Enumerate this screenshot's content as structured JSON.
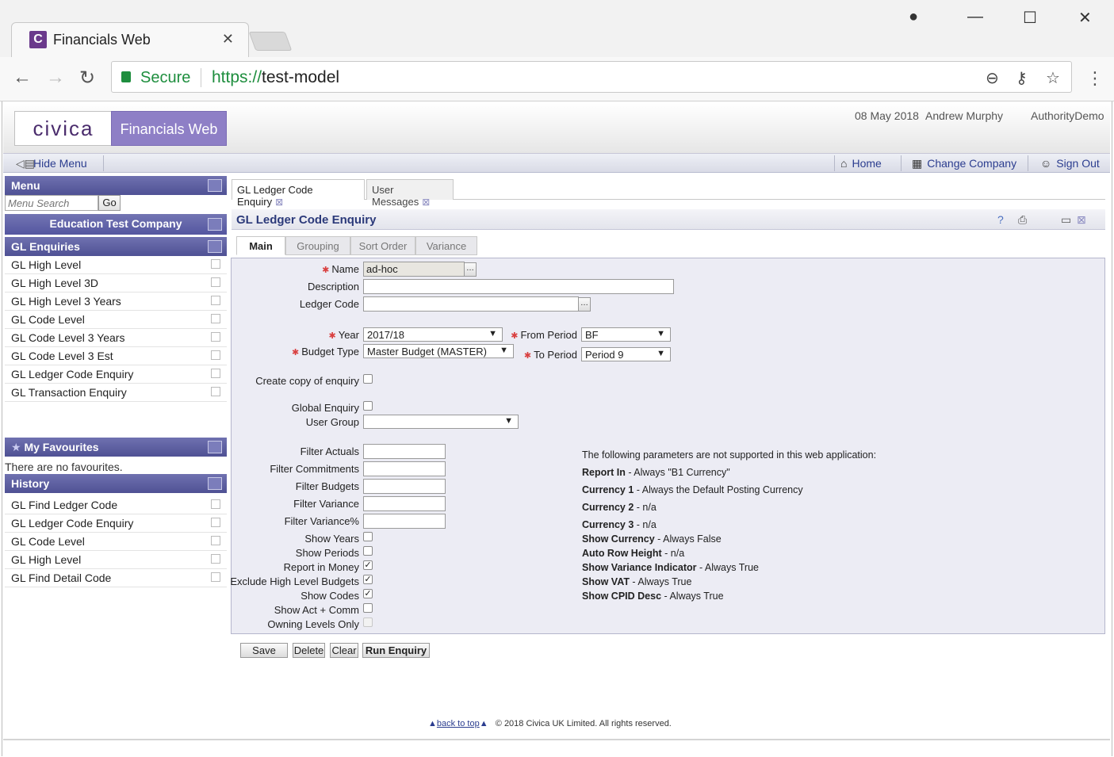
{
  "browser": {
    "tab_title": "Financials Web",
    "tab_logo": "C",
    "secure_label": "Secure",
    "url_scheme": "https://",
    "url_host": "test-model"
  },
  "header": {
    "logo_civica": "civica",
    "logo_product": "Financials Web",
    "date": "08 May 2018",
    "user": "Andrew Murphy",
    "authority": "AuthorityDemo"
  },
  "toolbar": {
    "hide_menu": "Hide Menu",
    "home": "Home",
    "change_company": "Change Company",
    "sign_out": "Sign Out"
  },
  "sidebar": {
    "menu_title": "Menu",
    "search_placeholder": "Menu Search",
    "go_label": "Go",
    "company": "Education Test Company",
    "enquiries_title": "GL Enquiries",
    "enquiries": [
      "GL High Level",
      "GL High Level 3D",
      "GL High Level 3 Years",
      "GL Code Level",
      "GL Code Level 3 Years",
      "GL Code Level 3 Est",
      "GL Ledger Code Enquiry",
      "GL Transaction Enquiry"
    ],
    "favourites_title": "My Favourites",
    "favourites_empty": "There are no favourites.",
    "history_title": "History",
    "history": [
      "GL Find Ledger Code",
      "GL Ledger Code Enquiry",
      "GL Code Level",
      "GL High Level",
      "GL Find Detail Code"
    ]
  },
  "content_tabs": [
    {
      "label": "GL Ledger Code Enquiry",
      "active": true
    },
    {
      "label": "User Messages",
      "active": false
    }
  ],
  "panel": {
    "title": "GL Ledger Code Enquiry"
  },
  "form_tabs": [
    "Main",
    "Grouping",
    "Sort Order",
    "Variance"
  ],
  "form": {
    "name_label": "Name",
    "name_value": "ad-hoc",
    "description_label": "Description",
    "ledger_code_label": "Ledger Code",
    "year_label": "Year",
    "year_value": "2017/18",
    "budget_type_label": "Budget Type",
    "budget_type_value": "Master Budget (MASTER)",
    "from_period_label": "From Period",
    "from_period_value": "BF",
    "to_period_label": "To Period",
    "to_period_value": "Period 9",
    "create_copy_label": "Create copy of enquiry",
    "global_enquiry_label": "Global Enquiry",
    "user_group_label": "User Group",
    "user_group_value": "",
    "filter_actuals_label": "Filter Actuals",
    "filter_commitments_label": "Filter Commitments",
    "filter_budgets_label": "Filter Budgets",
    "filter_variance_label": "Filter Variance",
    "filter_variance_pct_label": "Filter Variance%",
    "show_years_label": "Show Years",
    "show_periods_label": "Show Periods",
    "report_in_money_label": "Report in Money",
    "exclude_high_level_label": "Exclude High Level Budgets",
    "show_codes_label": "Show Codes",
    "show_act_comm_label": "Show Act + Comm",
    "owning_levels_label": "Owning Levels Only",
    "checks": {
      "create_copy": false,
      "global_enquiry": false,
      "show_years": false,
      "show_periods": false,
      "report_in_money": true,
      "exclude_high_level": true,
      "show_codes": true,
      "show_act_comm": false,
      "owning_levels": false
    }
  },
  "notes": {
    "intro": "The following parameters are not supported in this web application:",
    "items": [
      {
        "key": "Report In",
        "value": " - Always \"B1 Currency\""
      },
      {
        "key": "Currency 1",
        "value": " - Always the Default Posting Currency"
      },
      {
        "key": "Currency 2",
        "value": " - n/a"
      },
      {
        "key": "Currency 3",
        "value": " - n/a"
      },
      {
        "key": "Show Currency",
        "value": " - Always False"
      },
      {
        "key": "Auto Row Height",
        "value": " - n/a"
      },
      {
        "key": "Show Variance Indicator",
        "value": " - Always True"
      },
      {
        "key": "Show VAT",
        "value": " - Always True"
      },
      {
        "key": "Show CPID Desc",
        "value": " - Always True"
      }
    ]
  },
  "actions": {
    "save": "Save",
    "delete": "Delete",
    "clear": "Clear",
    "run": "Run Enquiry"
  },
  "footer": {
    "back_to_top": "back to top",
    "copyright": "© 2018 Civica UK Limited. All rights reserved."
  }
}
